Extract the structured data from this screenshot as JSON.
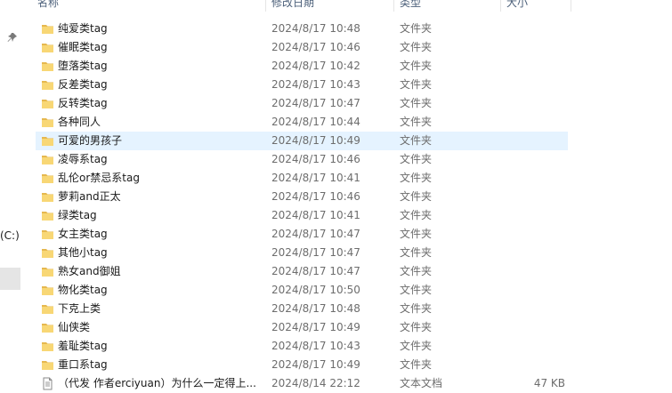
{
  "nav": {
    "drive_label": "(C:)",
    "pin_icon": "pin-icon"
  },
  "columns": {
    "name": "名称",
    "date": "修改日期",
    "type": "类型",
    "size": "大小"
  },
  "colors": {
    "folder": "#f8d775",
    "selected_row": "#e5f3ff",
    "header_text": "#4c607a"
  },
  "files": [
    {
      "name": "纯爱类tag",
      "date": "2024/8/17 10:48",
      "type": "文件夹",
      "size": "",
      "icon": "folder-icon",
      "selected": false
    },
    {
      "name": "催眠类tag",
      "date": "2024/8/17 10:46",
      "type": "文件夹",
      "size": "",
      "icon": "folder-icon",
      "selected": false
    },
    {
      "name": "堕落类tag",
      "date": "2024/8/17 10:42",
      "type": "文件夹",
      "size": "",
      "icon": "folder-icon",
      "selected": false
    },
    {
      "name": "反差类tag",
      "date": "2024/8/17 10:43",
      "type": "文件夹",
      "size": "",
      "icon": "folder-icon",
      "selected": false
    },
    {
      "name": "反转类tag",
      "date": "2024/8/17 10:47",
      "type": "文件夹",
      "size": "",
      "icon": "folder-icon",
      "selected": false
    },
    {
      "name": "各种同人",
      "date": "2024/8/17 10:44",
      "type": "文件夹",
      "size": "",
      "icon": "folder-icon",
      "selected": false
    },
    {
      "name": "可爱的男孩子",
      "date": "2024/8/17 10:49",
      "type": "文件夹",
      "size": "",
      "icon": "folder-icon",
      "selected": true
    },
    {
      "name": "凌辱系tag",
      "date": "2024/8/17 10:46",
      "type": "文件夹",
      "size": "",
      "icon": "folder-icon",
      "selected": false
    },
    {
      "name": "乱伦or禁忌系tag",
      "date": "2024/8/17 10:41",
      "type": "文件夹",
      "size": "",
      "icon": "folder-icon",
      "selected": false
    },
    {
      "name": "萝莉and正太",
      "date": "2024/8/17 10:46",
      "type": "文件夹",
      "size": "",
      "icon": "folder-icon",
      "selected": false
    },
    {
      "name": "绿类tag",
      "date": "2024/8/17 10:41",
      "type": "文件夹",
      "size": "",
      "icon": "folder-icon",
      "selected": false
    },
    {
      "name": "女主类tag",
      "date": "2024/8/17 10:47",
      "type": "文件夹",
      "size": "",
      "icon": "folder-icon",
      "selected": false
    },
    {
      "name": "其他小tag",
      "date": "2024/8/17 10:47",
      "type": "文件夹",
      "size": "",
      "icon": "folder-icon",
      "selected": false
    },
    {
      "name": "熟女and御姐",
      "date": "2024/8/17 10:47",
      "type": "文件夹",
      "size": "",
      "icon": "folder-icon",
      "selected": false
    },
    {
      "name": "物化类tag",
      "date": "2024/8/17 10:50",
      "type": "文件夹",
      "size": "",
      "icon": "folder-icon",
      "selected": false
    },
    {
      "name": "下克上类",
      "date": "2024/8/17 10:48",
      "type": "文件夹",
      "size": "",
      "icon": "folder-icon",
      "selected": false
    },
    {
      "name": "仙侠类",
      "date": "2024/8/17 10:49",
      "type": "文件夹",
      "size": "",
      "icon": "folder-icon",
      "selected": false
    },
    {
      "name": "羞耻类tag",
      "date": "2024/8/17 10:43",
      "type": "文件夹",
      "size": "",
      "icon": "folder-icon",
      "selected": false
    },
    {
      "name": "重口系tag",
      "date": "2024/8/17 10:49",
      "type": "文件夹",
      "size": "",
      "icon": "folder-icon",
      "selected": false
    },
    {
      "name": "（代发 作者erciyuan）为什么一定得上...",
      "date": "2024/8/14 22:12",
      "type": "文本文档",
      "size": "47 KB",
      "icon": "text-document-icon",
      "selected": false
    }
  ]
}
